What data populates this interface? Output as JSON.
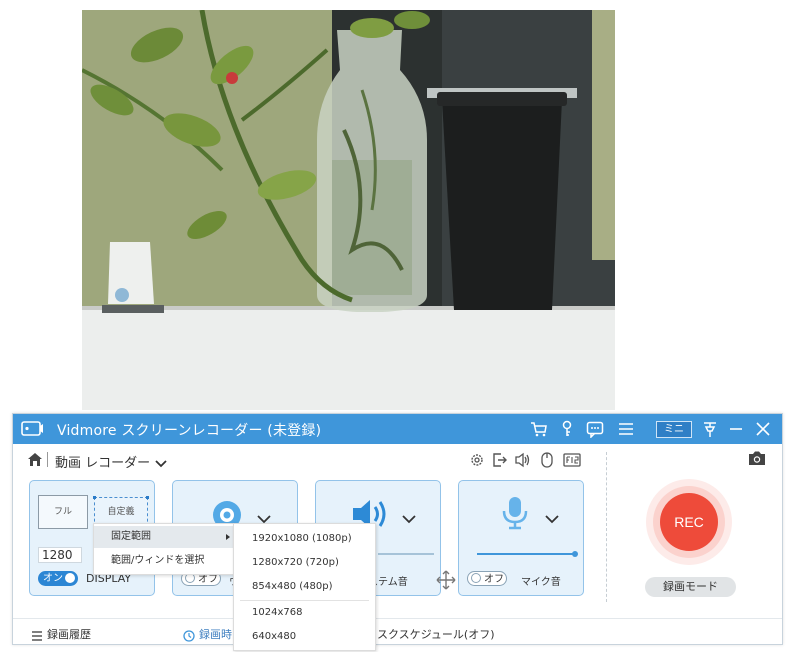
{
  "window": {
    "title": "Vidmore スクリーンレコーダー (未登録)",
    "mini_label": "ミニ",
    "accent": "#3f96da"
  },
  "toolbar": {
    "mode_label": "動画 レコーダー",
    "icons": [
      "gear-icon",
      "export-icon",
      "speaker-icon",
      "mouse-icon",
      "fps-icon",
      "camera-icon"
    ]
  },
  "display_panel": {
    "full_label": "フル",
    "custom_label": "自定義",
    "width_value": "1280",
    "toggle_label": "オン",
    "display_name": "DISPLAY"
  },
  "webcam_panel": {
    "toggle_label": "オフ",
    "partial_label": "ウ"
  },
  "system_audio_panel": {
    "label": "ステム音",
    "volume": 0.95
  },
  "mic_panel": {
    "toggle_label": "オフ",
    "label": "マイク音",
    "volume": 0.95
  },
  "record": {
    "rec_label": "REC",
    "mode_label": "録画モード"
  },
  "bottom": {
    "history": "録画履歴",
    "timer_partial": "録画時間",
    "schedule_partial": "スクスケジュール(オフ)"
  },
  "context_menu": {
    "items": [
      "固定範囲",
      "範囲/ウィンドを選択"
    ]
  },
  "resolution_menu": {
    "items": [
      "1920x1080 (1080p)",
      "1280x720 (720p)",
      "854x480 (480p)",
      "1024x768",
      "640x480"
    ]
  }
}
